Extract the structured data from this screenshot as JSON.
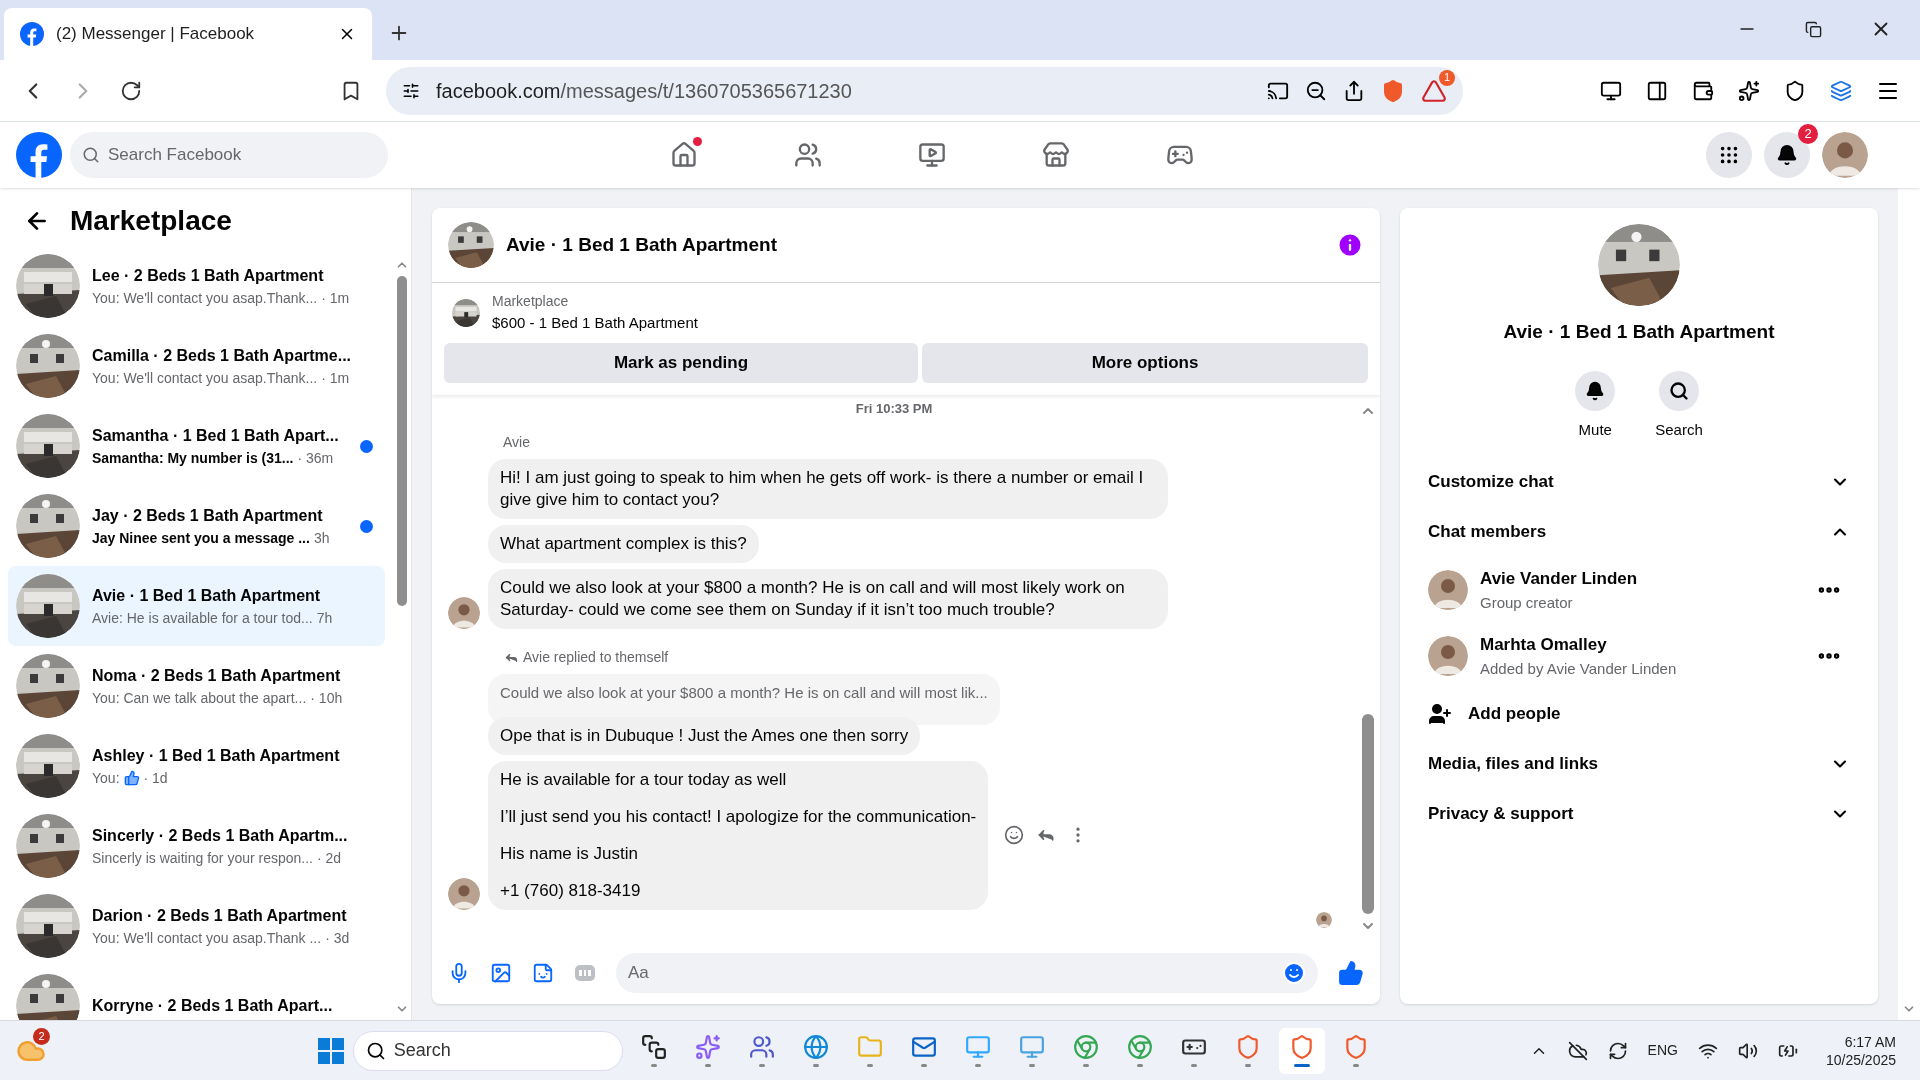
{
  "browser": {
    "tab_title": "(2) Messenger | Facebook",
    "url_host": "facebook.com",
    "url_path": "/messages/t/1360705365671230",
    "extension_badge": "1"
  },
  "header": {
    "search_placeholder": "Search Facebook",
    "nav": [
      {
        "kind": "home",
        "dot": true
      },
      {
        "kind": "friends",
        "dot": false
      },
      {
        "kind": "video",
        "dot": false
      },
      {
        "kind": "marketplace",
        "dot": false
      },
      {
        "kind": "gaming",
        "dot": false
      }
    ],
    "notification_badge": "2"
  },
  "sidebar": {
    "title": "Marketplace",
    "conversations": [
      {
        "title": "Lee · 2 Beds 1 Bath Apartment",
        "kind": "text",
        "preview": "You: We'll contact you asap.Thank...",
        "time": "· 1m",
        "unread": false,
        "selected": false
      },
      {
        "title": "Camilla · 2 Beds 1 Bath Apartme...",
        "kind": "text",
        "preview": "You: We'll contact you asap.Thank...",
        "time": "· 1m",
        "unread": false,
        "selected": false
      },
      {
        "title": "Samantha · 1 Bed 1 Bath Apart...",
        "kind": "text",
        "preview": "Samantha: My number is (31...",
        "time": "· 36m",
        "unread": true,
        "selected": false
      },
      {
        "title": "Jay · 2 Beds 1 Bath Apartment",
        "kind": "text",
        "preview": "Jay Ninee sent you a message ...",
        "time": "3h",
        "unread": true,
        "selected": false
      },
      {
        "title": "Avie · 1 Bed 1 Bath Apartment",
        "kind": "text",
        "preview": "Avie: He is available for a tour tod...",
        "time": "7h",
        "unread": false,
        "selected": true
      },
      {
        "title": "Noma · 2 Beds 1 Bath Apartment",
        "kind": "text",
        "preview": "You: Can we talk about the apart...",
        "time": "· 10h",
        "unread": false,
        "selected": false
      },
      {
        "title": "Ashley · 1 Bed 1 Bath Apartment",
        "kind": "like",
        "preview": "You:",
        "time": "· 1d",
        "unread": false,
        "selected": false
      },
      {
        "title": "Sincerly · 2 Beds 1 Bath Apartm...",
        "kind": "text",
        "preview": "Sincerly is waiting for your respon...",
        "time": "· 2d",
        "unread": false,
        "selected": false
      },
      {
        "title": "Darion · 2 Beds 1 Bath Apartment",
        "kind": "text",
        "preview": "You: We'll contact you asap.Thank ...",
        "time": "· 3d",
        "unread": false,
        "selected": false
      },
      {
        "title": "Korryne · 2 Beds 1 Bath Apart...",
        "kind": "partial",
        "unread": false,
        "selected": false
      }
    ]
  },
  "chat": {
    "title": "Avie · 1 Bed 1 Bath Apartment",
    "listing": {
      "label": "Marketplace",
      "title": "$600 - 1 Bed 1 Bath Apartment"
    },
    "buttons": [
      "Mark as pending",
      "More options"
    ],
    "timestamp": "Fri 10:33 PM",
    "messages": [
      {
        "kind": "sender",
        "text": "Avie"
      },
      {
        "kind": "bubble",
        "lines": [
          "Hi! I am just going to speak to him when he gets off work- is there a number or email I give give him to contact you?"
        ],
        "avatar": false,
        "hovered": false
      },
      {
        "kind": "bubble",
        "lines": [
          "What apartment complex is this?"
        ],
        "avatar": false,
        "hovered": false
      },
      {
        "kind": "bubble",
        "lines": [
          "Could we also look at your $800 a month? He is on call and will most likely work on Saturday- could we come see them on Sunday if it isn’t too much trouble?"
        ],
        "avatar": true,
        "hovered": false
      },
      {
        "kind": "reply_label",
        "text": "Avie replied to themself"
      },
      {
        "kind": "quote",
        "text": "Could we also look at your $800 a month? He is on call and will most lik..."
      },
      {
        "kind": "bubble",
        "lines": [
          "Ope that is in Dubuque ! Just the Ames one then sorry"
        ],
        "avatar": false,
        "hovered": false
      },
      {
        "kind": "bubble",
        "lines": [
          "He is available for a tour today as well",
          "I’ll just send you his contact! I apologize for the communication-",
          "His name is Justin",
          "+1 (760) 818-3419"
        ],
        "avatar": true,
        "hovered": true
      }
    ],
    "composer_placeholder": "Aa"
  },
  "details": {
    "title": "Avie · 1 Bed 1 Bath Apartment",
    "actions": [
      {
        "kind": "mute",
        "label": "Mute"
      },
      {
        "kind": "search",
        "label": "Search"
      }
    ],
    "items": [
      {
        "kind": "section",
        "label": "Customize chat",
        "expanded": false
      },
      {
        "kind": "section",
        "label": "Chat members",
        "expanded": true
      },
      {
        "kind": "member",
        "name": "Avie Vander Linden",
        "role": "Group creator"
      },
      {
        "kind": "member",
        "name": "Marhta Omalley",
        "role": "Added by Avie Vander Linden"
      },
      {
        "kind": "add",
        "label": "Add people"
      },
      {
        "kind": "section",
        "label": "Media, files and links",
        "expanded": false
      },
      {
        "kind": "section",
        "label": "Privacy & support",
        "expanded": false
      }
    ]
  },
  "taskbar": {
    "weather_badge": "2",
    "search": "Search",
    "apps": [
      {
        "kind": "taskview",
        "selected": false
      },
      {
        "kind": "copilot",
        "selected": false
      },
      {
        "kind": "teams",
        "selected": false
      },
      {
        "kind": "edge",
        "selected": false
      },
      {
        "kind": "files",
        "selected": false
      },
      {
        "kind": "outlook",
        "selected": false
      },
      {
        "kind": "photoshop",
        "selected": false
      },
      {
        "kind": "remote",
        "selected": false
      },
      {
        "kind": "chrome",
        "selected": false
      },
      {
        "kind": "chrome",
        "selected": false
      },
      {
        "kind": "game",
        "selected": false
      },
      {
        "kind": "brave",
        "selected": false
      },
      {
        "kind": "brave",
        "selected": true
      },
      {
        "kind": "brave",
        "selected": false
      }
    ],
    "language": "ENG",
    "time": "6:17 AM",
    "date": "10/25/2025"
  }
}
